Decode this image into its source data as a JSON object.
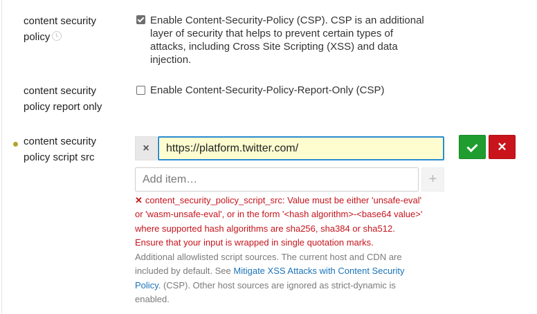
{
  "csp": {
    "label_line1": "content security",
    "label_line2": "policy",
    "checked": true,
    "checkbox_text_l1": "Enable Content-Security-Policy (CSP). CSP is an additional",
    "checkbox_text_l2": "layer of security that helps to prevent certain types of",
    "checkbox_text_l3": "attacks, including Cross Site Scripting (XSS) and data",
    "checkbox_text_l4": "injection."
  },
  "csp_report_only": {
    "label_line1": "content security",
    "label_line2": "policy report only",
    "checked": false,
    "checkbox_text": "Enable Content-Security-Policy-Report-Only (CSP)"
  },
  "csp_script_src": {
    "label_line1": "content security",
    "label_line2": "policy script src",
    "remove_glyph": "×",
    "value": "https://platform.twitter.com/",
    "cancel_glyph": "✕",
    "add_placeholder": "Add item…",
    "add_glyph": "+",
    "error_icon": "✕",
    "error_l1": "content_security_policy_script_src: Value must be either 'unsafe-eval'",
    "error_l2": "or 'wasm-unsafe-eval', or in the form '<hash algorithm>-<base64 value>'",
    "error_l3": "where supported hash algorithms are sha256, sha384 or sha512.",
    "error_l4": "Ensure that your input is wrapped in single quotation marks.",
    "help_l1": "Additional allowlisted script sources. The current host and CDN are",
    "help_l2_prefix": "included by default. See ",
    "help_link_part1": "Mitigate XSS Attacks with Content Security",
    "help_link_part2": "Policy",
    "help_l3_suffix": ". (CSP). Other host sources are ignored as strict-dynamic is",
    "help_l4": "enabled."
  },
  "colors": {
    "modified_dot": "#b3a32b",
    "save_button": "#1f9d2f",
    "cancel_button": "#c9141c",
    "error_text": "#c4141c",
    "link": "#1a73b8",
    "input_focus_border": "#2a8bd1",
    "input_highlight": "#fdfdd0"
  },
  "icons": {
    "history": "history-icon",
    "save": "check-icon",
    "cancel": "close-icon",
    "remove": "remove-item-icon",
    "add": "plus-icon",
    "error": "error-icon"
  }
}
